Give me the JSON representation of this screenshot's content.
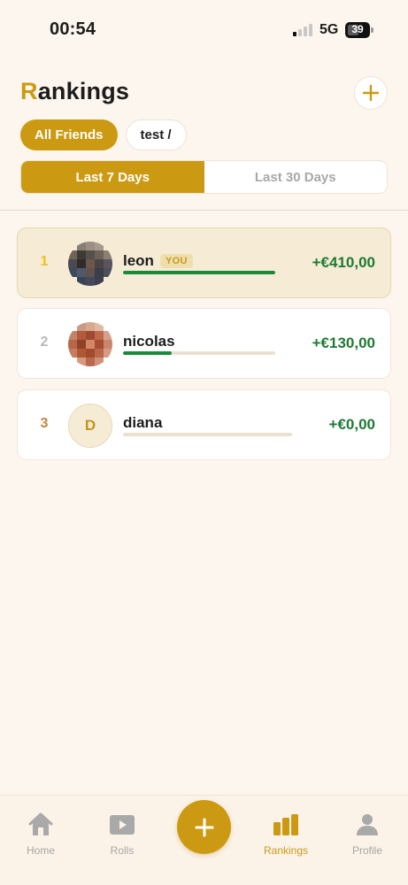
{
  "status_bar": {
    "time": "00:54",
    "network": "5G",
    "battery": "39"
  },
  "header": {
    "title_first_letter": "R",
    "title_rest": "ankings",
    "add_icon": "plus-icon"
  },
  "groups": [
    {
      "label": "All Friends",
      "active": true
    },
    {
      "label": "test /",
      "active": false
    }
  ],
  "periods": [
    {
      "label": "Last 7 Days",
      "active": true
    },
    {
      "label": "Last 30 Days",
      "active": false
    }
  ],
  "rankings": [
    {
      "rank": "1",
      "name": "leon",
      "badge": "YOU",
      "amount": "+€410,00",
      "progress": 1.0,
      "rank_color": "#f0c21a",
      "avatar": "blurred-photo"
    },
    {
      "rank": "2",
      "name": "nicolas",
      "amount": "+€130,00",
      "progress": 0.32,
      "rank_color": "#b9b9b9",
      "avatar": "blurred-photo"
    },
    {
      "rank": "3",
      "name": "diana",
      "initial": "D",
      "amount": "+€0,00",
      "progress": 0,
      "rank_color": "#c9843a",
      "avatar": "initial"
    }
  ],
  "nav": [
    {
      "label": "Home",
      "icon": "home-icon",
      "active": false
    },
    {
      "label": "Rolls",
      "icon": "play-icon",
      "active": false
    },
    {
      "label": "Rankings",
      "icon": "bar-chart-icon",
      "active": true
    },
    {
      "label": "Profile",
      "icon": "person-icon",
      "active": false
    }
  ],
  "fab_icon": "plus-icon",
  "colors": {
    "accent": "#cc9a12",
    "positive": "#1d7a33",
    "background": "#fdf6ee"
  }
}
